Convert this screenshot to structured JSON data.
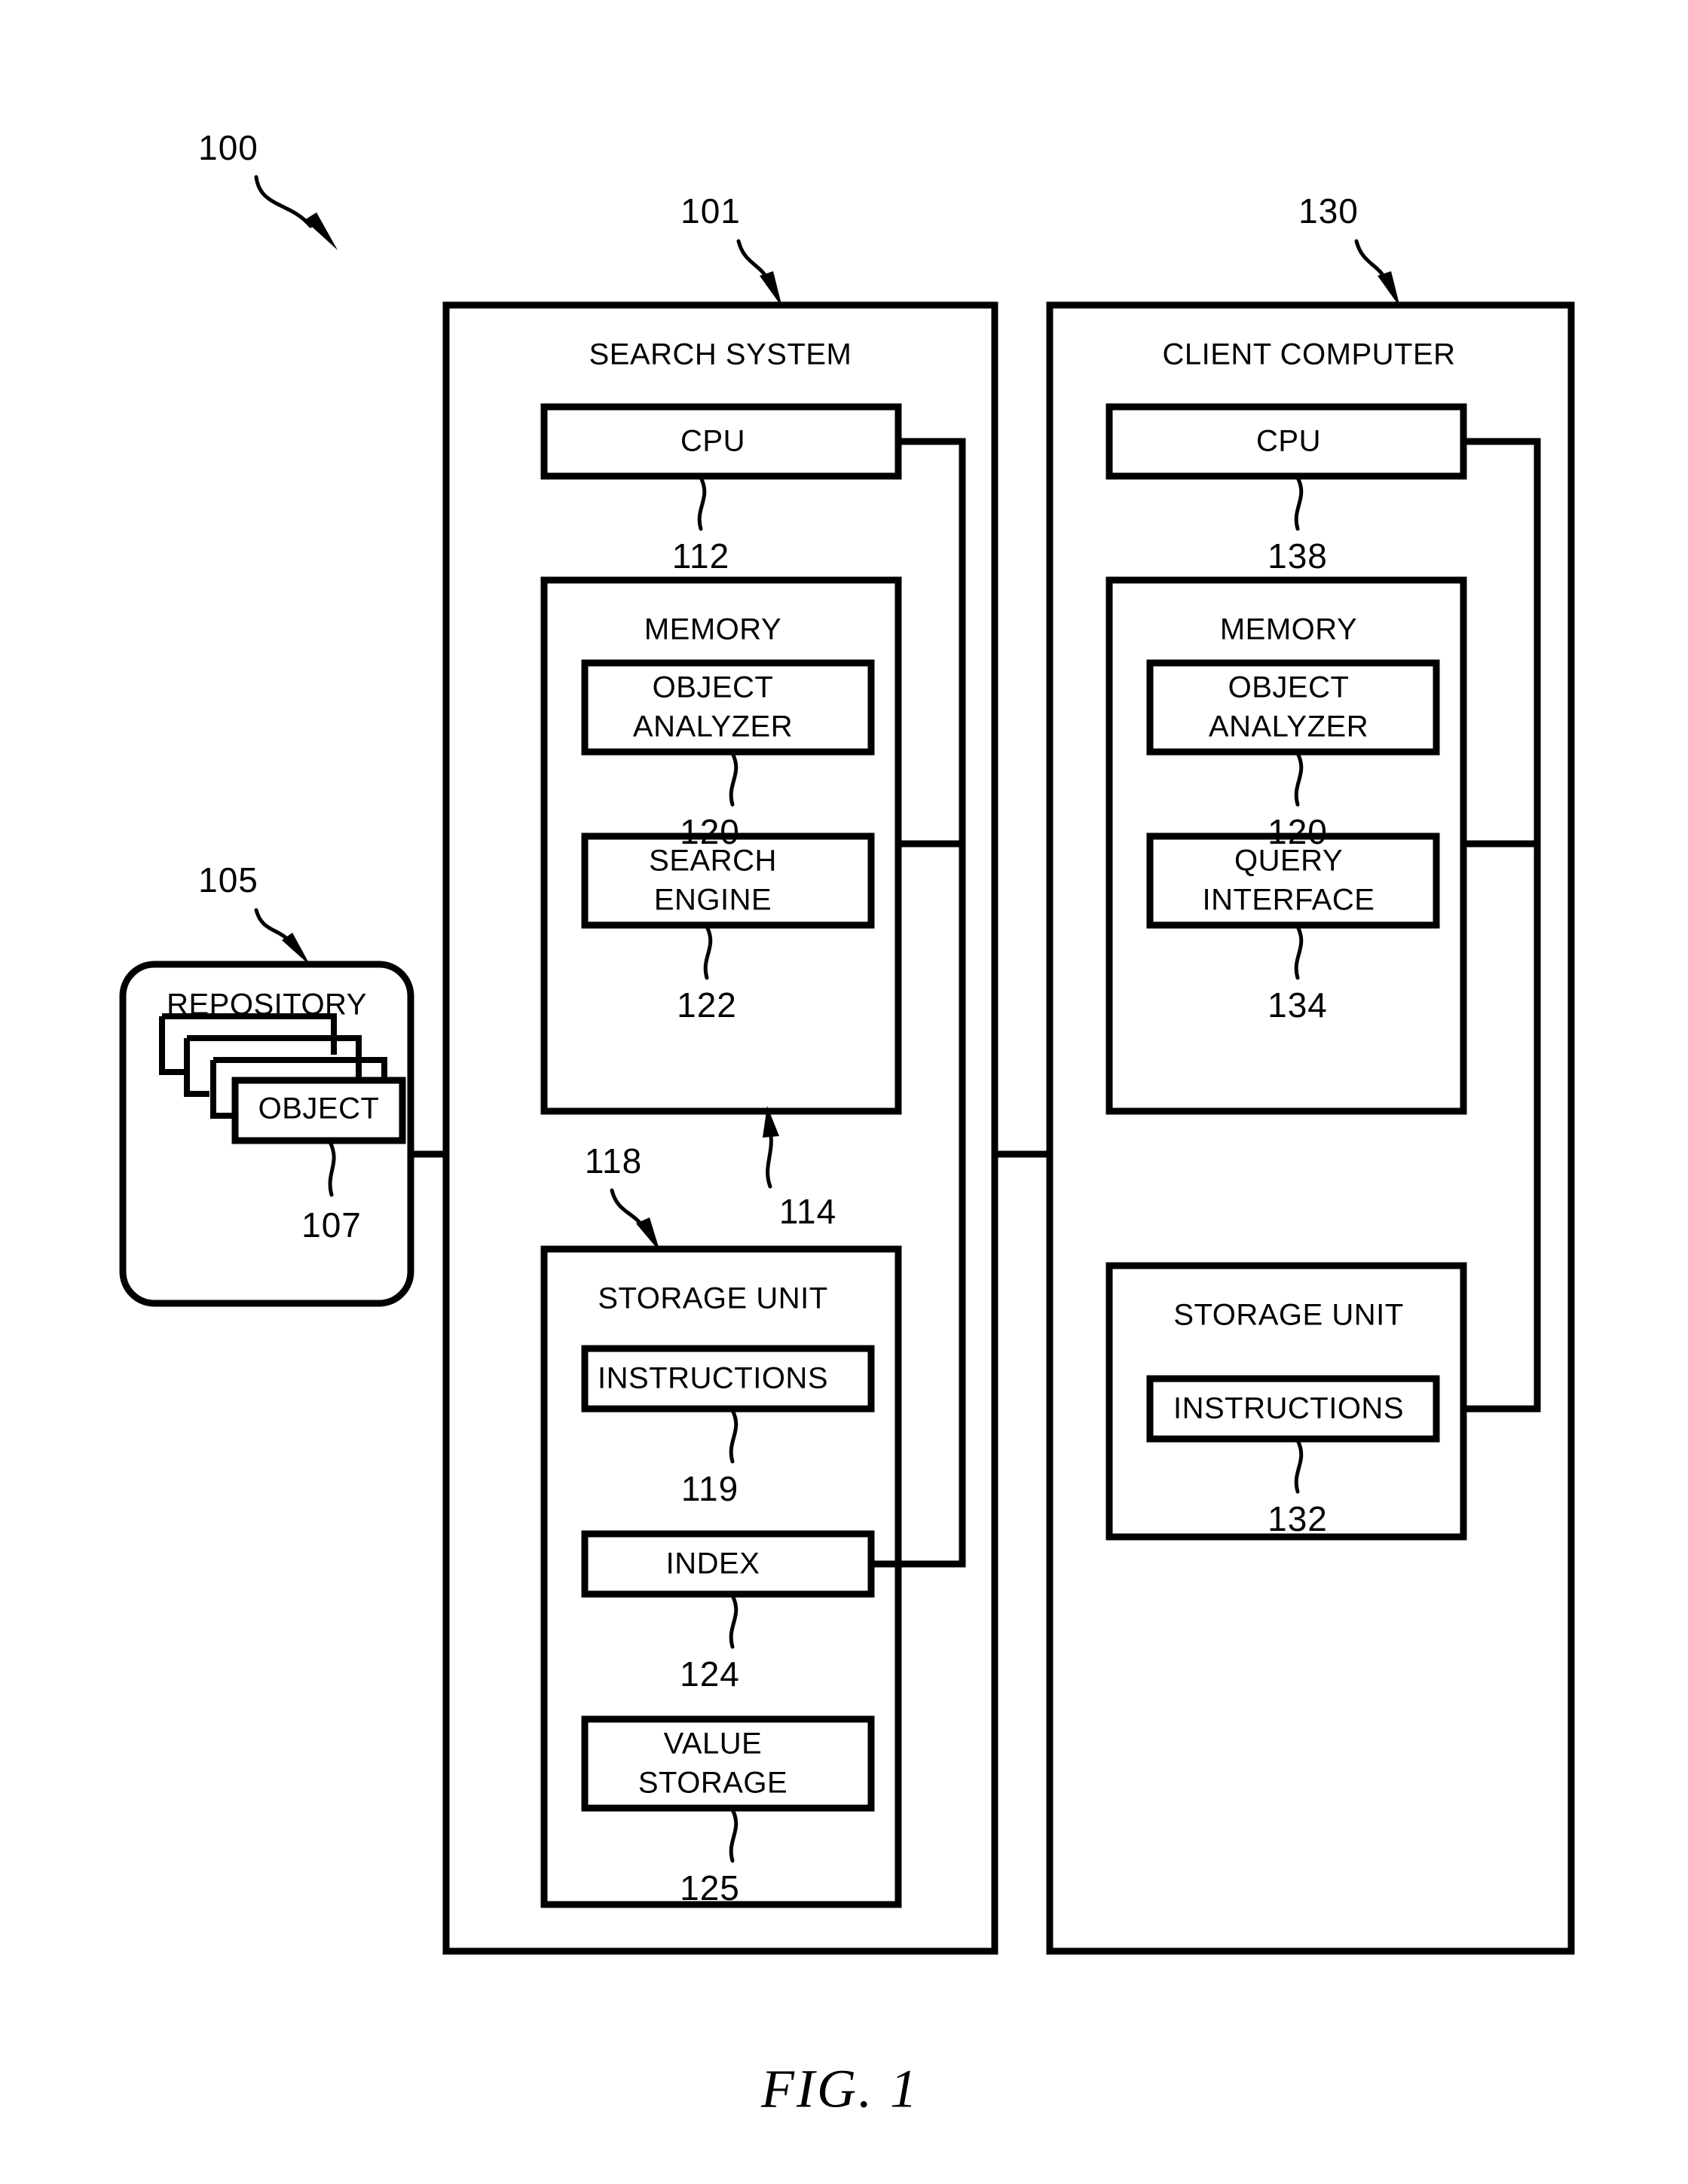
{
  "figure": {
    "caption": "FIG. 1",
    "system_ref": "100"
  },
  "repository": {
    "title": "REPOSITORY",
    "ref": "105",
    "object": {
      "label": "OBJECT",
      "ref": "107"
    }
  },
  "search_system": {
    "title": "SEARCH SYSTEM",
    "ref": "101",
    "cpu": {
      "label": "CPU",
      "ref": "112"
    },
    "memory": {
      "title": "MEMORY",
      "ref": "114",
      "modules": [
        {
          "label": "OBJECT ANALYZER",
          "line1": "OBJECT",
          "line2": "ANALYZER",
          "ref": "120"
        },
        {
          "label": "SEARCH ENGINE",
          "line1": "SEARCH",
          "line2": "ENGINE",
          "ref": "122"
        }
      ]
    },
    "storage_unit": {
      "title": "STORAGE UNIT",
      "ref": "118",
      "modules": [
        {
          "label": "INSTRUCTIONS",
          "line1": "INSTRUCTIONS",
          "line2": "",
          "ref": "119"
        },
        {
          "label": "INDEX",
          "line1": "INDEX",
          "line2": "",
          "ref": "124"
        },
        {
          "label": "VALUE STORAGE",
          "line1": "VALUE",
          "line2": "STORAGE",
          "ref": "125"
        }
      ]
    }
  },
  "client_computer": {
    "title": "CLIENT COMPUTER",
    "ref": "130",
    "cpu": {
      "label": "CPU",
      "ref": "138"
    },
    "memory": {
      "title": "MEMORY",
      "modules": [
        {
          "label": "OBJECT ANALYZER",
          "line1": "OBJECT",
          "line2": "ANALYZER",
          "ref": "120"
        },
        {
          "label": "QUERY INTERFACE",
          "line1": "QUERY",
          "line2": "INTERFACE",
          "ref": "134"
        }
      ]
    },
    "storage_unit": {
      "title": "STORAGE UNIT",
      "modules": [
        {
          "label": "INSTRUCTIONS",
          "line1": "INSTRUCTIONS",
          "line2": "",
          "ref": "132"
        }
      ]
    }
  },
  "colors": {
    "ink": "#000000",
    "paper": "#ffffff"
  }
}
